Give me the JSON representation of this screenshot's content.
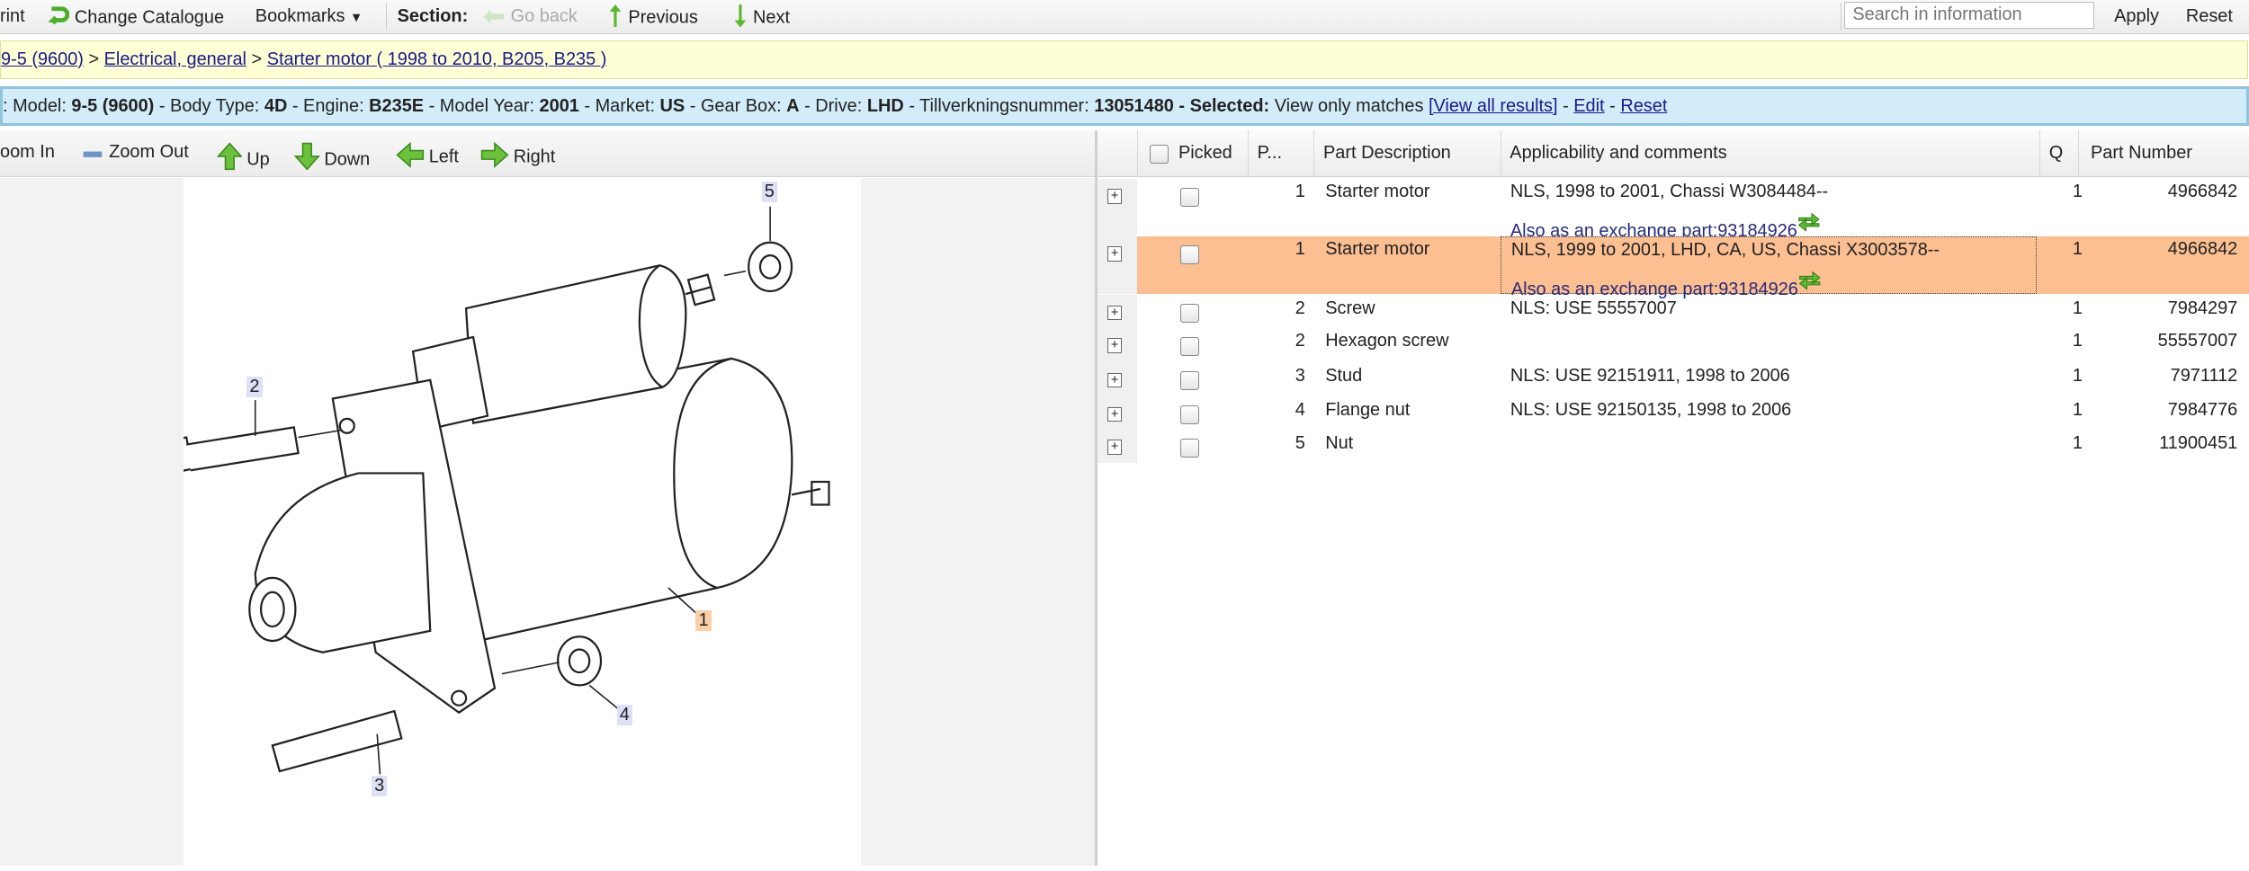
{
  "toolbar": {
    "print": "rint",
    "change_catalogue": "Change Catalogue",
    "bookmarks": "Bookmarks",
    "section": "Section:",
    "go_back": "Go back",
    "previous": "Previous",
    "next": "Next",
    "search_placeholder": "Search in information",
    "apply": "Apply",
    "reset": "Reset"
  },
  "breadcrumb": [
    {
      "label": "9-5 (9600)"
    },
    {
      "label": "Electrical, general"
    },
    {
      "label": "Starter motor ( 1998 to 2010, B205, B235 )"
    }
  ],
  "info": {
    "model_label": ": Model: ",
    "model": "9-5 (9600)",
    "body_label": " - Body Type: ",
    "body": "4D",
    "engine_label": " - Engine: ",
    "engine": "B235E",
    "year_label": " - Model Year: ",
    "year": "2001",
    "market_label": " - Market: ",
    "market": "US",
    "gear_label": " - Gear Box: ",
    "gear": "A",
    "drive_label": " - Drive: ",
    "drive": "LHD",
    "tn_label": " - Tillverkningsnummer: ",
    "tn": "13051480",
    "sel_label": " - Selected: ",
    "sel": "View only matches ",
    "view_all": "[View all results]",
    "edit": "Edit",
    "reset": "Reset"
  },
  "diagram_toolbar": {
    "zoom_in": "oom In",
    "zoom_out": "Zoom Out",
    "up": "Up",
    "down": "Down",
    "left": "Left",
    "right": "Right"
  },
  "callouts": [
    "1",
    "2",
    "3",
    "4",
    "5"
  ],
  "table": {
    "headers": {
      "picked": "Picked",
      "pos": "P...",
      "desc": "Part Description",
      "appl": "Applicability and comments",
      "q": "Q",
      "pn": "Part Number"
    },
    "rows": [
      {
        "pos": "1",
        "desc": "Starter motor",
        "appl": "NLS, 1998 to 2001, Chassi W3084484--",
        "exchange": "Also as an exchange part:93184926",
        "q": "1",
        "pn": "4966842",
        "selected": false
      },
      {
        "pos": "1",
        "desc": "Starter motor",
        "appl": "NLS, 1999 to 2001, LHD, CA, US, Chassi X3003578--",
        "exchange": "Also as an exchange part:93184926",
        "q": "1",
        "pn": "4966842",
        "selected": true
      },
      {
        "pos": "2",
        "desc": "Screw",
        "appl": "NLS: USE 55557007",
        "q": "1",
        "pn": "7984297"
      },
      {
        "pos": "2",
        "desc": "Hexagon screw",
        "appl": "",
        "q": "1",
        "pn": "55557007"
      },
      {
        "pos": "3",
        "desc": "Stud",
        "appl": "NLS: USE 92151911, 1998 to 2006",
        "q": "1",
        "pn": "7971112"
      },
      {
        "pos": "4",
        "desc": "Flange nut",
        "appl": "NLS: USE 92150135, 1998 to 2006",
        "q": "1",
        "pn": "7984776"
      },
      {
        "pos": "5",
        "desc": "Nut",
        "appl": "",
        "q": "1",
        "pn": "11900451"
      }
    ]
  },
  "colors": {
    "selected_row": "#fbbf92",
    "breadcrumb_bg": "#ffffd6",
    "info_bg": "#d3ecfa",
    "icon_green": "#5cb82e"
  }
}
